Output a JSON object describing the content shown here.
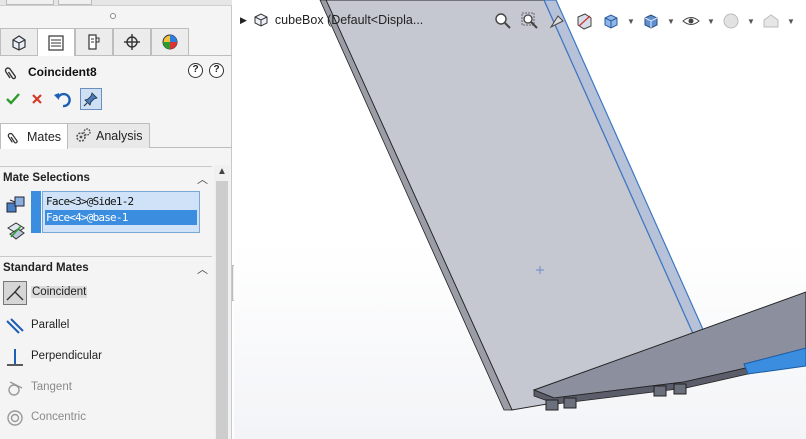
{
  "feature": {
    "title": "Coincident8"
  },
  "tabs": {
    "mates": "Mates",
    "analysis": "Analysis"
  },
  "sections": {
    "mate_selections": "Mate Selections",
    "standard_mates": "Standard Mates"
  },
  "selections": [
    "Face<3>@Side1-2",
    "Face<4>@base-1"
  ],
  "standard_mates": [
    {
      "label": "Coincident",
      "icon": "coincident-icon",
      "selected": true,
      "enabled": true
    },
    {
      "label": "Parallel",
      "icon": "parallel-icon",
      "selected": false,
      "enabled": true
    },
    {
      "label": "Perpendicular",
      "icon": "perpendicular-icon",
      "selected": false,
      "enabled": true
    },
    {
      "label": "Tangent",
      "icon": "tangent-icon",
      "selected": false,
      "enabled": false
    },
    {
      "label": "Concentric",
      "icon": "concentric-icon",
      "selected": false,
      "enabled": false
    }
  ],
  "viewport": {
    "tree_label": "cubeBox  (Default<Displa..."
  },
  "colors": {
    "selection_blue": "#3b8de0",
    "ok_green": "#2e9b2e",
    "cancel_red": "#d23a2a",
    "part_gray": "#c4c6d0"
  }
}
